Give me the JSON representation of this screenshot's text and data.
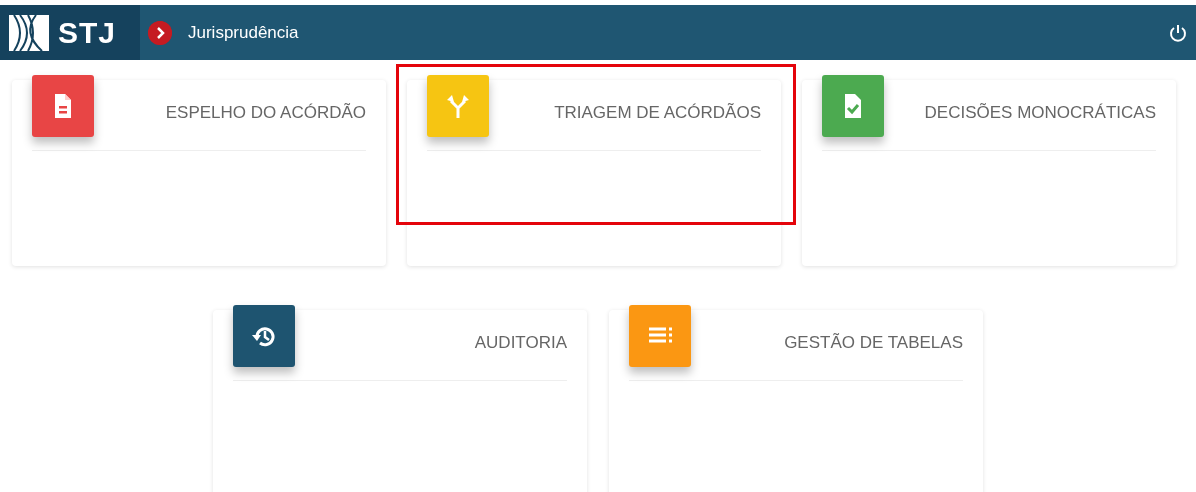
{
  "header": {
    "logo": "STJ",
    "section": "Jurisprudência"
  },
  "cards": [
    {
      "title": "ESPELHO DO ACÓRDÃO",
      "kind": "document",
      "color": "#e84545",
      "highlighted": false
    },
    {
      "title": "TRIAGEM DE ACÓRDÃOS",
      "kind": "merge",
      "color": "#f6c512",
      "highlighted": true
    },
    {
      "title": "DECISÕES MONOCRÁTICAS",
      "kind": "doccheck",
      "color": "#4caa50",
      "highlighted": false
    },
    {
      "title": "AUDITORIA",
      "kind": "history",
      "color": "#1e5470",
      "highlighted": false
    },
    {
      "title": "GESTÃO DE TABELAS",
      "kind": "list",
      "color": "#fb9712",
      "highlighted": false
    }
  ]
}
